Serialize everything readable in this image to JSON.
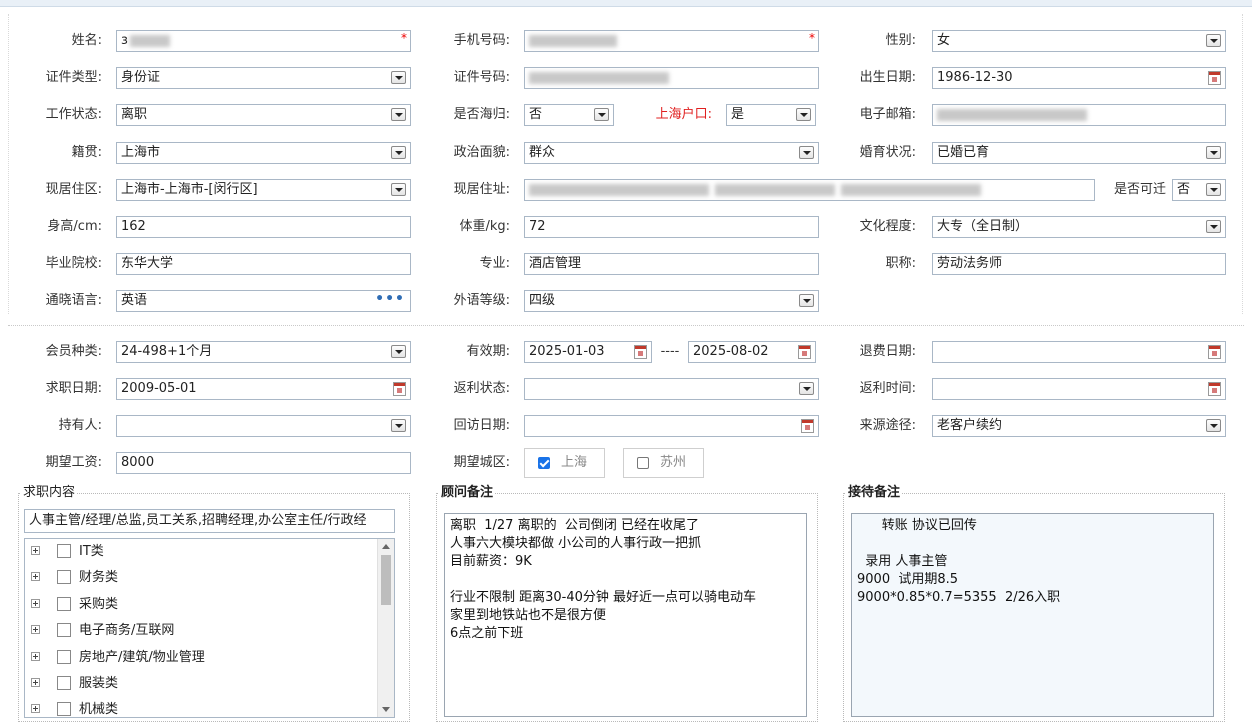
{
  "basic": {
    "name": {
      "label": "姓名:",
      "value": "з",
      "required": "*"
    },
    "phone": {
      "label": "手机号码:",
      "required": "*"
    },
    "gender": {
      "label": "性别:",
      "value": "女"
    },
    "id_type": {
      "label": "证件类型:",
      "value": "身份证"
    },
    "id_no": {
      "label": "证件号码:"
    },
    "birth": {
      "label": "出生日期:",
      "value": "1986-12-30"
    },
    "work_status": {
      "label": "工作状态:",
      "value": "离职"
    },
    "returnee": {
      "label": "是否海归:",
      "value": "否"
    },
    "shanghai_hukou": {
      "label": "上海户口:",
      "value": "是"
    },
    "email": {
      "label": "电子邮箱:"
    },
    "native": {
      "label": "籍贯:",
      "value": "上海市"
    },
    "politics": {
      "label": "政治面貌:",
      "value": "群众"
    },
    "marital": {
      "label": "婚育状况:",
      "value": "已婚已育"
    },
    "district": {
      "label": "现居住区:",
      "value": "上海市-上海市-[闵行区]"
    },
    "address": {
      "label": "现居住址:"
    },
    "relocate": {
      "label": "是否可迁",
      "value": "否"
    },
    "height": {
      "label": "身高/cm:",
      "value": "162"
    },
    "weight": {
      "label": "体重/kg:",
      "value": "72"
    },
    "education": {
      "label": "文化程度:",
      "value": "大专（全日制）"
    },
    "school": {
      "label": "毕业院校:",
      "value": "东华大学"
    },
    "major": {
      "label": "专业:",
      "value": "酒店管理"
    },
    "title": {
      "label": "职称:",
      "value": "劳动法务师"
    },
    "language": {
      "label": "通晓语言:",
      "value": "英语"
    },
    "lang_level": {
      "label": "外语等级:",
      "value": "四级"
    }
  },
  "member": {
    "type": {
      "label": "会员种类:",
      "value": "24-498+1个月"
    },
    "valid": {
      "label": "有效期:",
      "from": "2025-01-03",
      "sep": "----",
      "to": "2025-08-02"
    },
    "refund_date": {
      "label": "退费日期:"
    },
    "job_date": {
      "label": "求职日期:",
      "value": "2009-05-01"
    },
    "rebate_status": {
      "label": "返利状态:"
    },
    "rebate_time": {
      "label": "返利时间:"
    },
    "holder": {
      "label": "持有人:"
    },
    "visit_date": {
      "label": "回访日期:"
    },
    "source": {
      "label": "来源途径:",
      "value": "老客户续约"
    },
    "salary": {
      "label": "期望工资:",
      "value": "8000"
    },
    "city": {
      "label": "期望城区:",
      "options": [
        {
          "label": "上海",
          "checked": true
        },
        {
          "label": "苏州",
          "checked": false
        }
      ]
    }
  },
  "job": {
    "title": "求职内容",
    "summary": "人事主管/经理/总监,员工关系,招聘经理,办公室主任/行政经",
    "tree": [
      "IT类",
      "财务类",
      "采购类",
      "电子商务/互联网",
      "房地产/建筑/物业管理",
      "服装类",
      "机械类"
    ]
  },
  "advisor_note": {
    "title": "顾问备注",
    "lines": [
      "离职  1/27 离职的  公司倒闭 已经在收尾了",
      "人事六大模块都做 小公司的人事行政一把抓",
      "目前薪资：9K",
      "",
      "行业不限制 距离30-40分钟 最好近一点可以骑电动车",
      "家里到地铁站也不是很方便",
      "6点之前下班"
    ]
  },
  "reception_note": {
    "title": "接待备注",
    "lines": [
      "      转账 协议已回传",
      "",
      "  录用 人事主管",
      "9000  试用期8.5",
      "9000*0.85*0.7=5355  2/26入职"
    ]
  },
  "icons": {
    "dropdown": "chevron-down-icon",
    "calendar": "calendar-icon",
    "more": "ellipsis-icon",
    "expand": "plus-icon"
  }
}
